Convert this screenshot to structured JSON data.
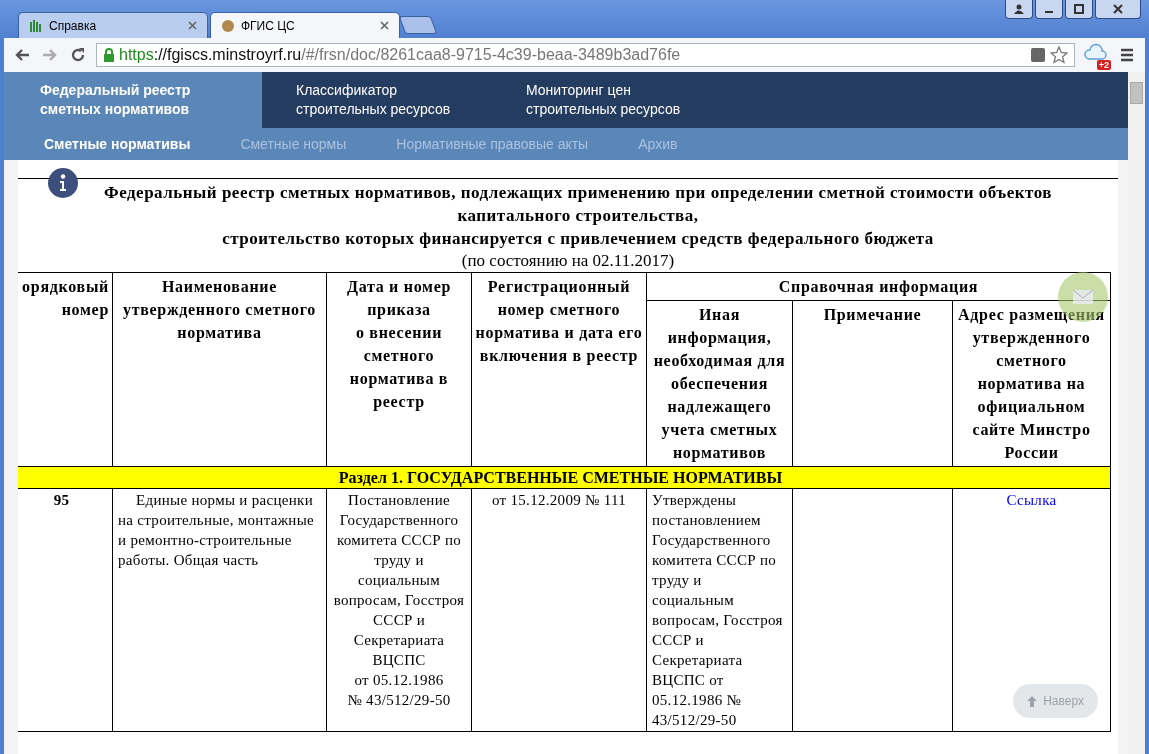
{
  "browser": {
    "tabs": [
      {
        "title": "Справка",
        "selected": false
      },
      {
        "title": "ФГИС ЦС",
        "selected": true
      }
    ],
    "url": {
      "scheme": "https",
      "host": "://fgiscs.minstroyrf.ru",
      "path": "/#/frsn/doc/8261caa8-9715-4c39-beaa-3489b3ad76fe"
    },
    "extension_badge": "+2"
  },
  "site_nav": [
    {
      "lines": [
        "Федеральный реестр",
        "сметных нормативов"
      ],
      "selected": true
    },
    {
      "lines": [
        "Классификатор",
        "строительных ресурсов"
      ],
      "selected": false
    },
    {
      "lines": [
        "Мониторинг цен",
        "строительных ресурсов"
      ],
      "selected": false
    }
  ],
  "sub_nav": [
    {
      "label": "Сметные нормативы",
      "selected": true
    },
    {
      "label": "Сметные нормы",
      "selected": false
    },
    {
      "label": "Нормативные правовые акты",
      "selected": false
    },
    {
      "label": "Архив",
      "selected": false
    }
  ],
  "document": {
    "title_lines": [
      "Федеральный реестр сметных нормативов, подлежащих применению при определении сметной стоимости объектов капитального строительства,",
      "строительство которых финансируется с привлечением средств федерального бюджета"
    ],
    "date_line": "(по состоянию на 02.11.2017)",
    "columns": [
      "орядковый номер",
      "Наименование утвержденного сметного норматива",
      "Дата и номер приказа\nо внесении сметного норматива в реестр",
      "Регистрационный номер сметного норматива и дата его включения в реестр"
    ],
    "group_header": "Справочная информация",
    "sub_columns": [
      "Иная информация, необходимая для обеспечения надлежащего учета сметных нормативов",
      "Примечание",
      "Адрес размещения утвержденного сметного норматива на официальном сайте Минстро\nРоссии"
    ],
    "section": "Раздел 1. ГОСУДАРСТВЕННЫЕ СМЕТНЫЕ НОРМАТИВЫ",
    "rows": [
      {
        "cells": [
          {
            "kind": "number",
            "text": "95"
          },
          {
            "kind": "text",
            "text": "Единые нормы и расценки на строительные, монтажные и ремонтно-строительные работы. Общая часть"
          },
          {
            "kind": "center",
            "text": "Постановление Государственного комитета СССР по труду и социальным вопросам, Госстроя СССР и Секретариата ВЦСПС\nот 05.12.1986\n№ 43/512/29-50"
          },
          {
            "kind": "center",
            "text": "от 15.12.2009 № 111"
          },
          {
            "kind": "plain",
            "text": "Утверждены постановлением Государственного комитета СССР по труду и социальным вопросам, Госстроя СССР и Секретариата ВЦСПС от 05.12.1986 № 43/512/29-50"
          },
          {
            "kind": "center",
            "text": ""
          },
          {
            "kind": "link",
            "text": "Ссылка"
          }
        ]
      }
    ]
  },
  "back_to_top": "Наверх"
}
